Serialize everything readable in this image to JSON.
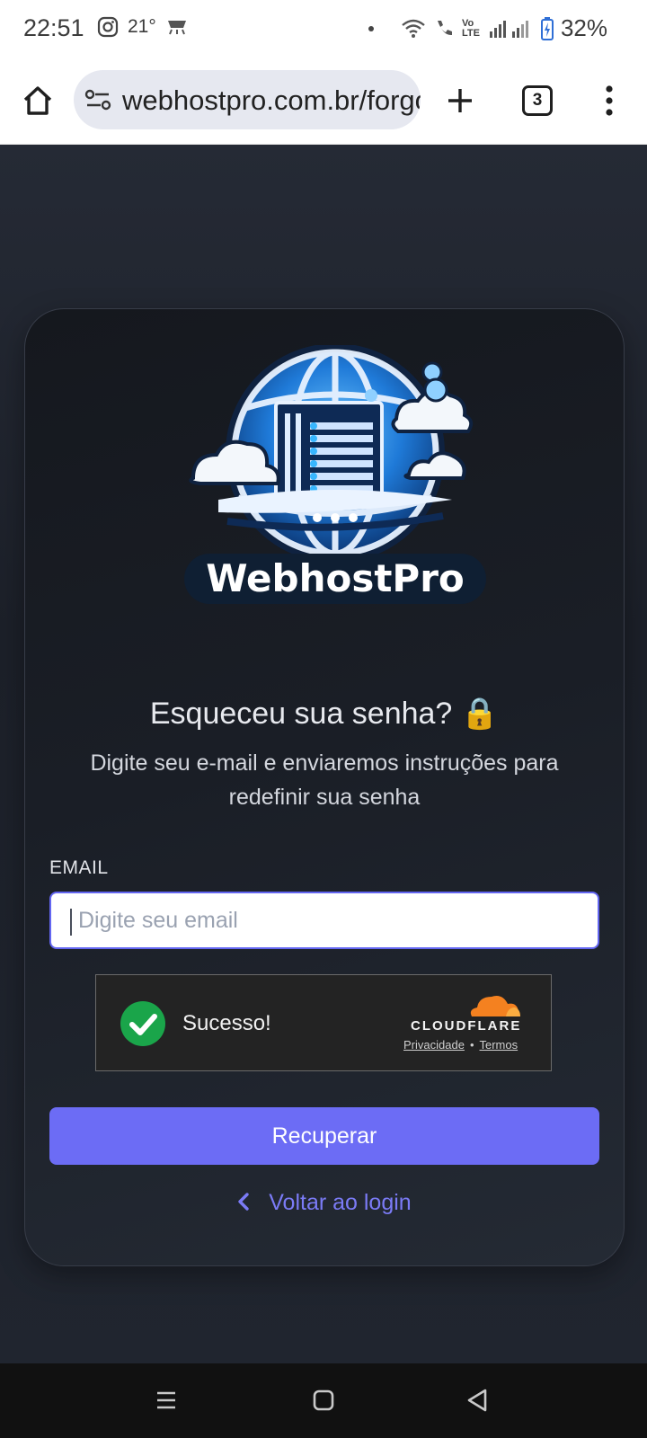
{
  "status_bar": {
    "time": "22:51",
    "temperature": "21°",
    "battery": "32%",
    "icons": [
      "instagram-icon",
      "weather-icon",
      "wifi-icon",
      "wifi-call-icon",
      "volte-icon",
      "signal-icon",
      "battery-charging-icon"
    ],
    "volte_text": "Vo LTE"
  },
  "browser": {
    "url": "webhostpro.com.br/forgot-password",
    "tab_count": "3",
    "icons": [
      "home-icon",
      "site-settings-icon",
      "new-tab-icon",
      "tab-switcher-icon",
      "menu-icon"
    ]
  },
  "logo": {
    "text": "WebhostPro"
  },
  "form": {
    "title": "Esqueceu sua senha? 🔒",
    "subtitle": "Digite seu e-mail e enviaremos instruções para redefinir sua senha",
    "email_label": "EMAIL",
    "email_placeholder": "Digite seu email",
    "submit_label": "Recuperar",
    "back_label": "Voltar ao login"
  },
  "turnstile": {
    "status": "Sucesso!",
    "brand": "CLOUDFLARE",
    "privacy": "Privacidade",
    "separator": "•",
    "terms": "Termos"
  },
  "colors": {
    "accent": "#6c6cf5",
    "link": "#7b7bf6",
    "success": "#1aa54a",
    "cloudflare_orange": "#f48120"
  },
  "nav": {
    "icons": [
      "recents-icon",
      "home-button-icon",
      "back-icon"
    ]
  }
}
